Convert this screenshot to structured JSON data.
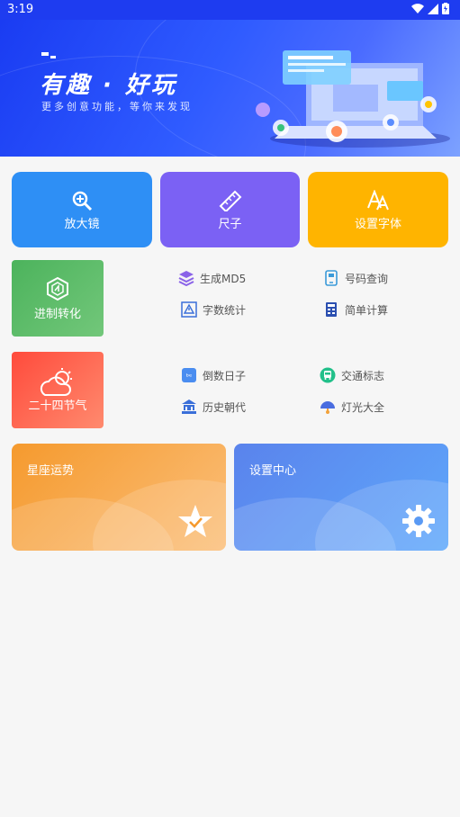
{
  "status": {
    "time": "3:19"
  },
  "banner": {
    "title": "有趣 · 好玩",
    "subtitle": "更多创意功能，等你来发现"
  },
  "top_cards": [
    {
      "label": "放大镜",
      "icon": "magnifier-icon"
    },
    {
      "label": "尺子",
      "icon": "ruler-icon"
    },
    {
      "label": "设置字体",
      "icon": "font-icon"
    }
  ],
  "row1": {
    "card": {
      "label": "进制转化",
      "icon": "hexagon-icon"
    },
    "items": [
      {
        "label": "生成MD5",
        "icon": "layers-icon"
      },
      {
        "label": "号码查询",
        "icon": "phone-icon"
      },
      {
        "label": "字数统计",
        "icon": "warning-doc-icon"
      },
      {
        "label": "简单计算",
        "icon": "calculator-icon"
      }
    ]
  },
  "row2": {
    "card": {
      "label": "二十四节气",
      "icon": "cloud-sun-icon"
    },
    "items": [
      {
        "label": "倒数日子",
        "icon": "calendar-icon"
      },
      {
        "label": "交通标志",
        "icon": "bus-icon"
      },
      {
        "label": "历史朝代",
        "icon": "temple-icon"
      },
      {
        "label": "灯光大全",
        "icon": "lamp-icon"
      }
    ]
  },
  "bottom_cards": [
    {
      "label": "星座运势",
      "icon": "star-icon",
      "color": "#f59a2e"
    },
    {
      "label": "设置中心",
      "icon": "gear-icon",
      "color": "#5a83ec"
    }
  ]
}
